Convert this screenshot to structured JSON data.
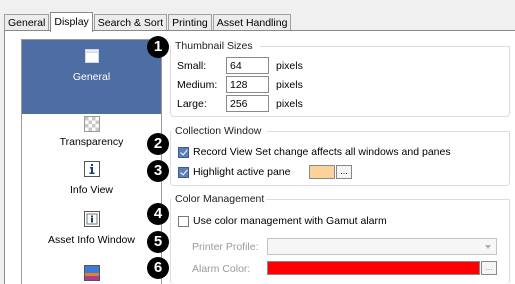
{
  "tabs": [
    {
      "label": "General"
    },
    {
      "label": "Display"
    },
    {
      "label": "Search & Sort"
    },
    {
      "label": "Printing"
    },
    {
      "label": "Asset Handling"
    }
  ],
  "sidebar": {
    "items": [
      {
        "label": "General",
        "icon": "window-icon",
        "selected": true
      },
      {
        "label": "Transparency",
        "icon": "checkerboard-icon"
      },
      {
        "label": "Info View",
        "icon": "info-icon"
      },
      {
        "label": "Asset Info Window",
        "icon": "asset-info-icon"
      },
      {
        "label": "",
        "icon": "image-icon"
      }
    ]
  },
  "thumbnail_sizes": {
    "title": "Thumbnail Sizes",
    "badge": "1",
    "small_label": "Small:",
    "small_value": "64",
    "medium_label": "Medium:",
    "medium_value": "128",
    "large_label": "Large:",
    "large_value": "256",
    "unit": "pixels"
  },
  "collection_window": {
    "title": "Collection Window",
    "record_view_badge": "2",
    "record_view_label": "Record View Set change affects all windows and panes",
    "record_view_checked": true,
    "highlight_badge": "3",
    "highlight_label": "Highlight active pane",
    "highlight_checked": true,
    "highlight_color": "#fbd39a",
    "dots": "..."
  },
  "color_management": {
    "title": "Color Management",
    "gamut_badge": "4",
    "gamut_label": "Use color management with Gamut alarm",
    "gamut_checked": false,
    "printer_badge": "5",
    "printer_label": "Printer Profile:",
    "printer_value": "",
    "alarm_badge": "6",
    "alarm_label": "Alarm Color:",
    "alarm_color": "#ff0000",
    "dots": "..."
  },
  "colors": {
    "selected_bg": "#4e6ea3",
    "checkbox_checked": "#5b7fb6"
  }
}
